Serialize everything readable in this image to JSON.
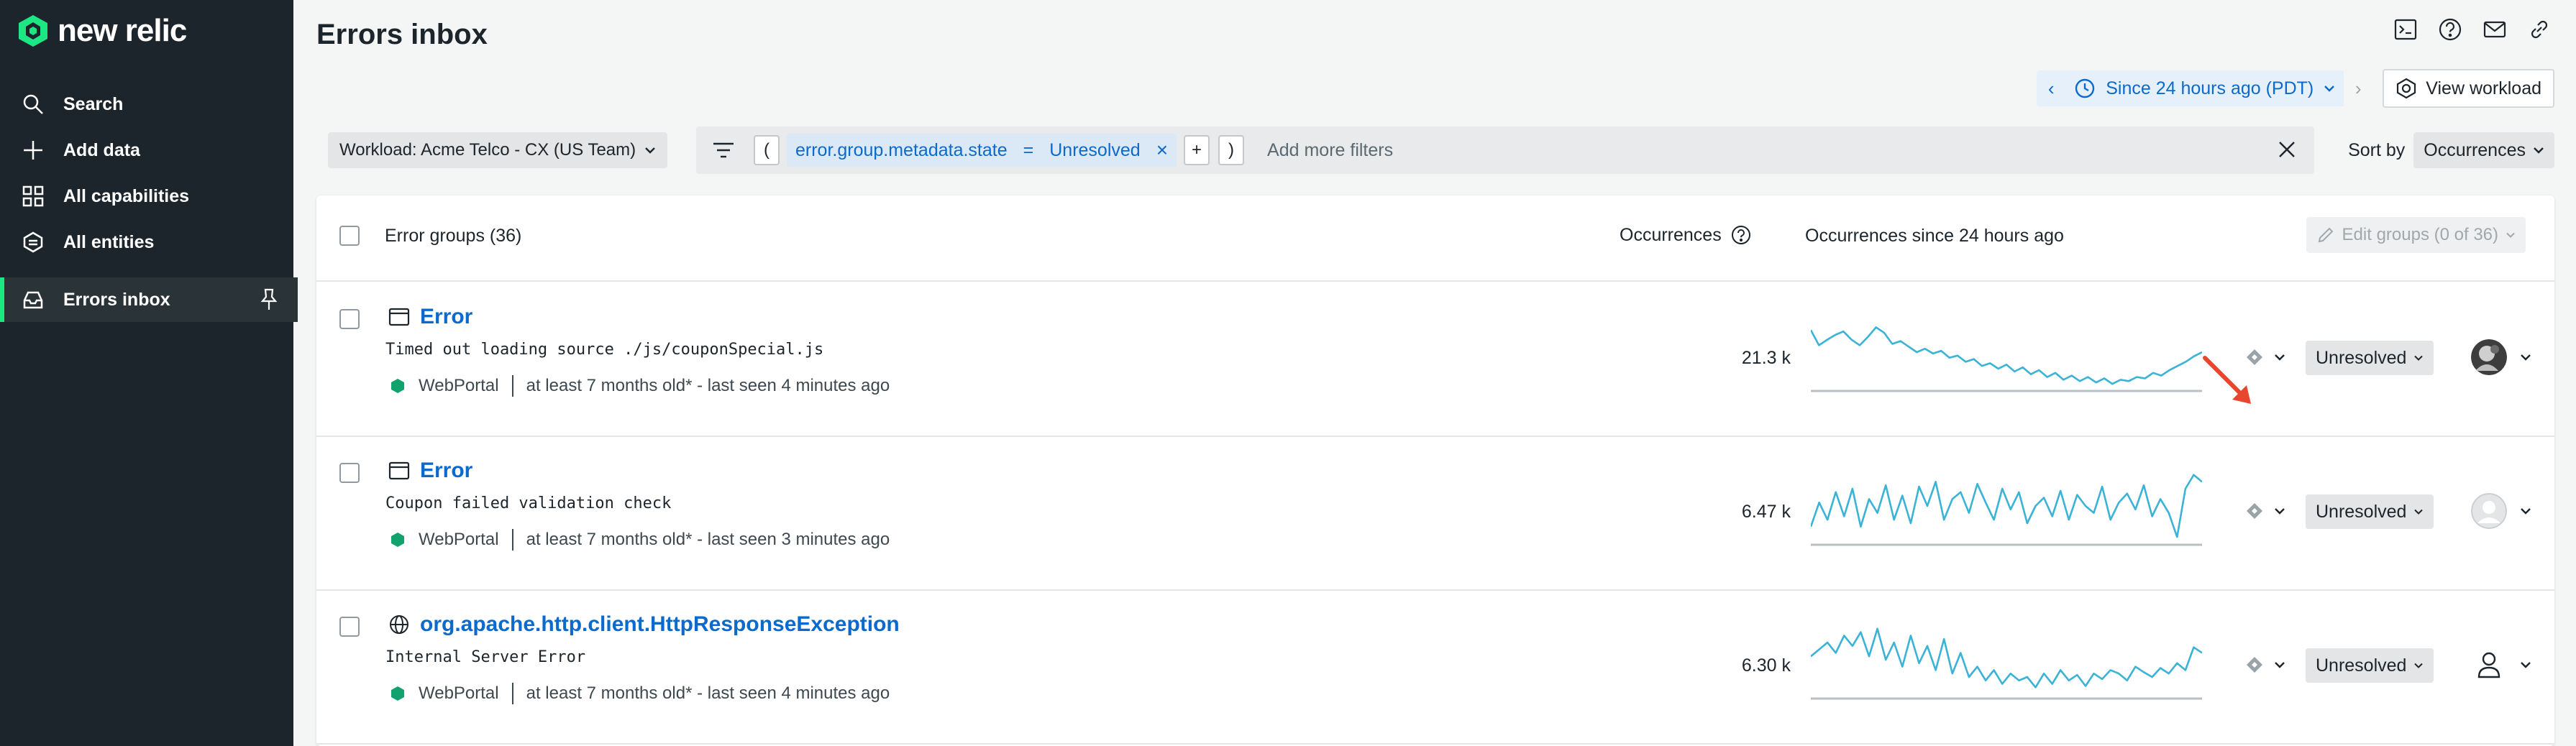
{
  "app": {
    "brand": "new relic"
  },
  "sidebar": {
    "items": [
      {
        "label": "Search",
        "icon": "search-icon"
      },
      {
        "label": "Add data",
        "icon": "plus-icon"
      },
      {
        "label": "All capabilities",
        "icon": "grid-icon"
      },
      {
        "label": "All entities",
        "icon": "entities-icon"
      },
      {
        "label": "Errors inbox",
        "icon": "inbox-icon",
        "active": true
      }
    ]
  },
  "header": {
    "title": "Errors inbox",
    "time_range": "Since 24 hours ago (PDT)",
    "view_workload": "View workload"
  },
  "filters": {
    "workload": "Workload: Acme Telco - CX (US Team)",
    "open_paren": "(",
    "close_paren": ")",
    "plus": "+",
    "clause_key": "error.group.metadata.state",
    "clause_op": "=",
    "clause_value": "Unresolved",
    "clause_remove": "×",
    "placeholder": "Add more filters",
    "sort_label": "Sort by",
    "sort_value": "Occurrences"
  },
  "table": {
    "group_count_label": "Error groups (36)",
    "occurrences_header": "Occurrences",
    "trend_header": "Occurrences since 24 hours ago",
    "edit_groups": "Edit groups (0 of 36)",
    "rows": [
      {
        "title": "Error",
        "type_icon": "browser-window-icon",
        "message": "Timed out loading source ./js/couponSpecial.js",
        "entity": "WebPortal",
        "age": "at least 7 months old* - last seen 4 minutes ago",
        "occurrences": "21.3 k",
        "status": "Unresolved",
        "assignee": "photo-avatar",
        "sparkline": [
          0.82,
          0.6,
          0.68,
          0.75,
          0.8,
          0.68,
          0.6,
          0.72,
          0.86,
          0.78,
          0.62,
          0.66,
          0.58,
          0.5,
          0.55,
          0.48,
          0.52,
          0.42,
          0.45,
          0.36,
          0.4,
          0.3,
          0.34,
          0.26,
          0.32,
          0.22,
          0.28,
          0.18,
          0.24,
          0.14,
          0.2,
          0.1,
          0.16,
          0.08,
          0.14,
          0.06,
          0.12,
          0.04,
          0.1,
          0.08,
          0.14,
          0.12,
          0.2,
          0.16,
          0.24,
          0.3,
          0.36,
          0.44,
          0.5
        ]
      },
      {
        "title": "Error",
        "type_icon": "browser-window-icon",
        "message": "Coupon failed validation check",
        "entity": "WebPortal",
        "age": "at least 7 months old* - last seen 3 minutes ago",
        "occurrences": "6.47 k",
        "status": "Unresolved",
        "assignee": "blank-avatar",
        "sparkline": [
          0.2,
          0.55,
          0.3,
          0.7,
          0.35,
          0.75,
          0.2,
          0.6,
          0.4,
          0.8,
          0.3,
          0.65,
          0.25,
          0.78,
          0.5,
          0.85,
          0.3,
          0.6,
          0.7,
          0.4,
          0.82,
          0.55,
          0.3,
          0.75,
          0.45,
          0.7,
          0.25,
          0.5,
          0.62,
          0.35,
          0.72,
          0.3,
          0.66,
          0.5,
          0.4,
          0.78,
          0.3,
          0.55,
          0.68,
          0.45,
          0.8,
          0.35,
          0.6,
          0.4,
          0.05,
          0.75,
          0.95,
          0.85
        ]
      },
      {
        "title": "org.apache.http.client.HttpResponseException",
        "type_icon": "globe-icon",
        "message": "Internal Server Error",
        "entity": "WebPortal",
        "age": "at least 7 months old* - last seen 4 minutes ago",
        "occurrences": "6.30 k",
        "status": "Unresolved",
        "assignee": "person-outline",
        "sparkline": [
          0.55,
          0.65,
          0.75,
          0.6,
          0.85,
          0.7,
          0.9,
          0.55,
          0.95,
          0.5,
          0.75,
          0.4,
          0.85,
          0.45,
          0.7,
          0.35,
          0.8,
          0.3,
          0.6,
          0.25,
          0.4,
          0.2,
          0.35,
          0.15,
          0.3,
          0.2,
          0.25,
          0.1,
          0.3,
          0.15,
          0.35,
          0.2,
          0.28,
          0.12,
          0.3,
          0.22,
          0.35,
          0.3,
          0.2,
          0.4,
          0.32,
          0.25,
          0.38,
          0.3,
          0.45,
          0.35,
          0.68,
          0.6
        ]
      }
    ]
  },
  "colors": {
    "sidebar_bg": "#1d252c",
    "accent_green": "#1ce783",
    "link_blue": "#0b6acb",
    "spark_blue": "#3bb3d6",
    "entity_hex": "#12a26e",
    "annotation_red": "#e8472e"
  }
}
